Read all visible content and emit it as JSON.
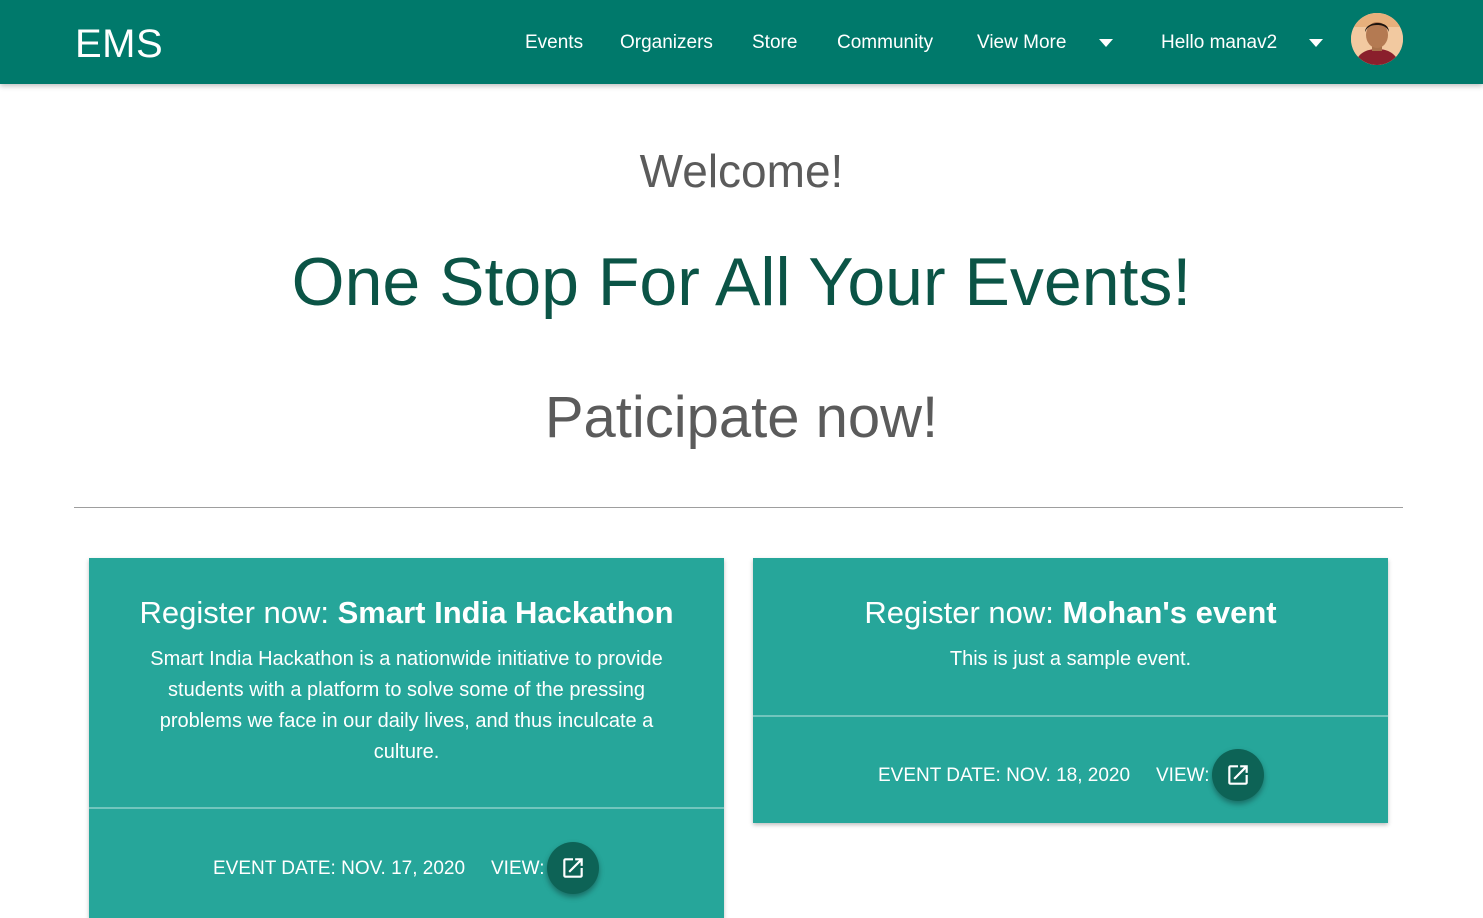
{
  "nav": {
    "brand": "EMS",
    "links": [
      "Events",
      "Organizers",
      "Store",
      "Community",
      "View More"
    ],
    "greeting": "Hello manav2"
  },
  "hero": {
    "welcome": "Welcome!",
    "tagline": "One Stop For All Your Events!",
    "cta": "Paticipate now!"
  },
  "events": [
    {
      "prefix": "Register now:",
      "name": "Smart India Hackathon",
      "description": "Smart India Hackathon is a nationwide initiative to provide students with a platform to solve some of the pressing problems we face in our daily lives, and thus inculcate a culture.",
      "date": "EVENT DATE: NOV. 17, 2020",
      "view_label": "VIEW:"
    },
    {
      "prefix": "Register now:",
      "name": "Mohan's event",
      "description": "This is just a sample event.",
      "date": "EVENT DATE: NOV. 18, 2020",
      "view_label": "VIEW:"
    }
  ],
  "colors": {
    "navbar": "#00796b",
    "card": "#26a69a",
    "fab": "#0d6356",
    "tagline": "#0b5446"
  },
  "icons": {
    "view_button": "open-in-new-icon",
    "menu_toggle": "caret-down-icon"
  }
}
